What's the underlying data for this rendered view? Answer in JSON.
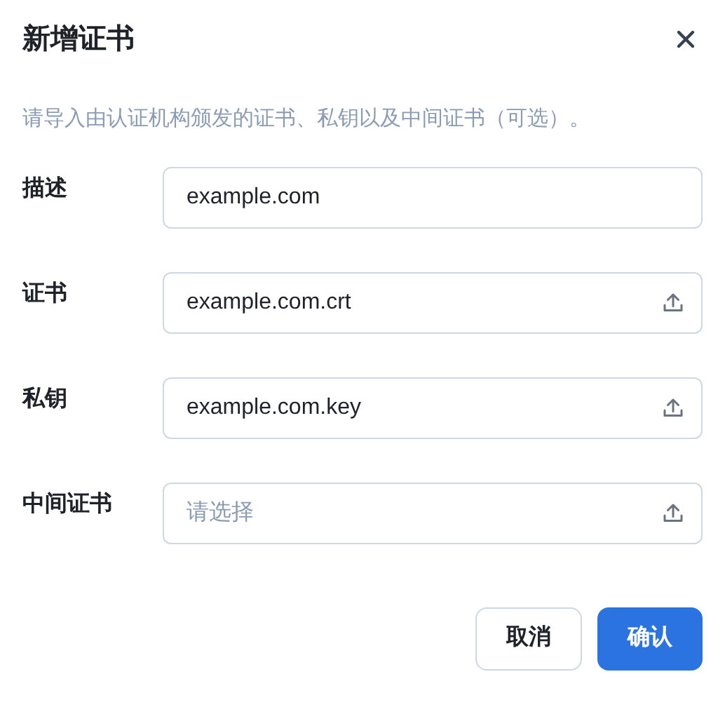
{
  "dialog": {
    "title": "新增证书",
    "description": "请导入由认证机构颁发的证书、私钥以及中间证书（可选）。"
  },
  "fields": [
    {
      "label": "描述",
      "kind": "text",
      "value": "example.com"
    },
    {
      "label": "证书",
      "kind": "upload",
      "value": "example.com.crt"
    },
    {
      "label": "私钥",
      "kind": "upload",
      "value": "example.com.key"
    },
    {
      "label": "中间证书",
      "kind": "upload",
      "placeholder": "请选择"
    }
  ],
  "buttons": [
    {
      "label": "取消",
      "kind": "secondary"
    },
    {
      "label": "确认",
      "kind": "primary"
    }
  ]
}
